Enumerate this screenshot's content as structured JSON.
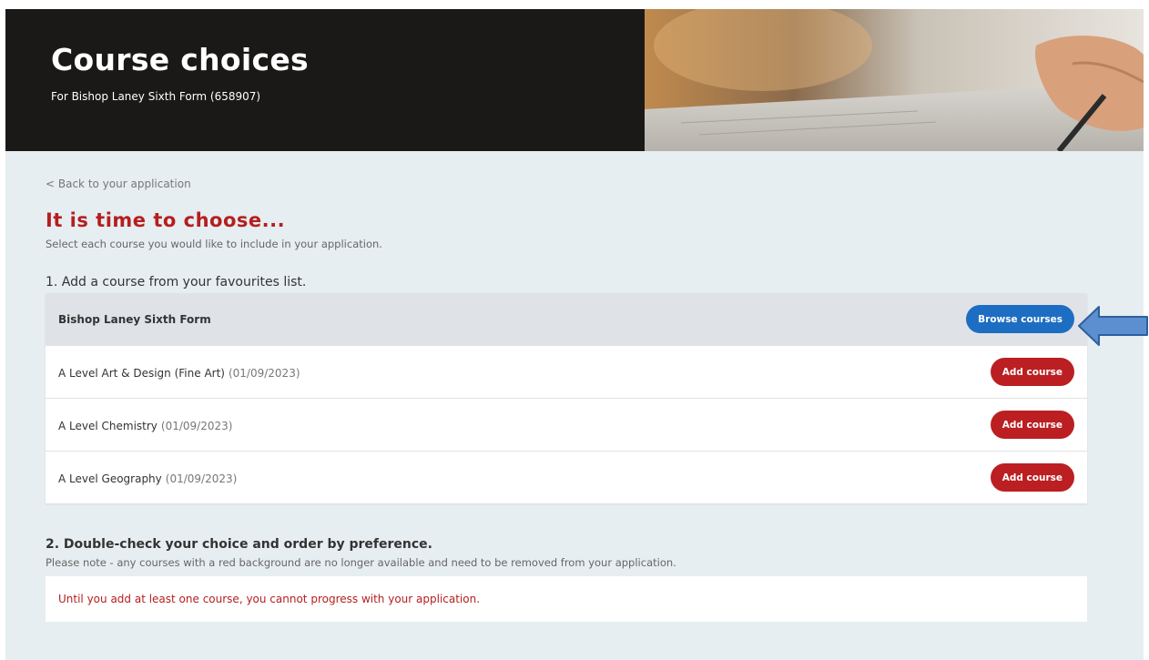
{
  "header": {
    "title": "Course choices",
    "subtitle": "For Bishop Laney Sixth Form (658907)"
  },
  "nav": {
    "back_label": "< Back to your application"
  },
  "main": {
    "heading": "It is time to choose...",
    "intro": "Select each course you would like to include in your application.",
    "step1_title": "1. Add a course from your favourites list.",
    "school_name": "Bishop Laney Sixth Form",
    "browse_label": "Browse courses",
    "courses": [
      {
        "name": "A Level Art & Design (Fine Art)",
        "date": "(01/09/2023)",
        "action": "Add course"
      },
      {
        "name": "A Level Chemistry",
        "date": "(01/09/2023)",
        "action": "Add course"
      },
      {
        "name": "A Level Geography",
        "date": "(01/09/2023)",
        "action": "Add course"
      }
    ],
    "step2_title": "2. Double-check your choice and order by preference.",
    "step2_note": "Please note - any courses with a red background are no longer available and need to be removed from your application.",
    "warning": "Until you add at least one course, you cannot progress with your application."
  },
  "colors": {
    "accent_red": "#b51e1e",
    "button_blue": "#1d6ec2",
    "button_red": "#bb1f22",
    "header_dark": "#1b1818",
    "page_bg": "#e6eef1",
    "annotation_arrow": "#5b8fd0"
  },
  "icons": {
    "annotation": "left-arrow-icon"
  }
}
